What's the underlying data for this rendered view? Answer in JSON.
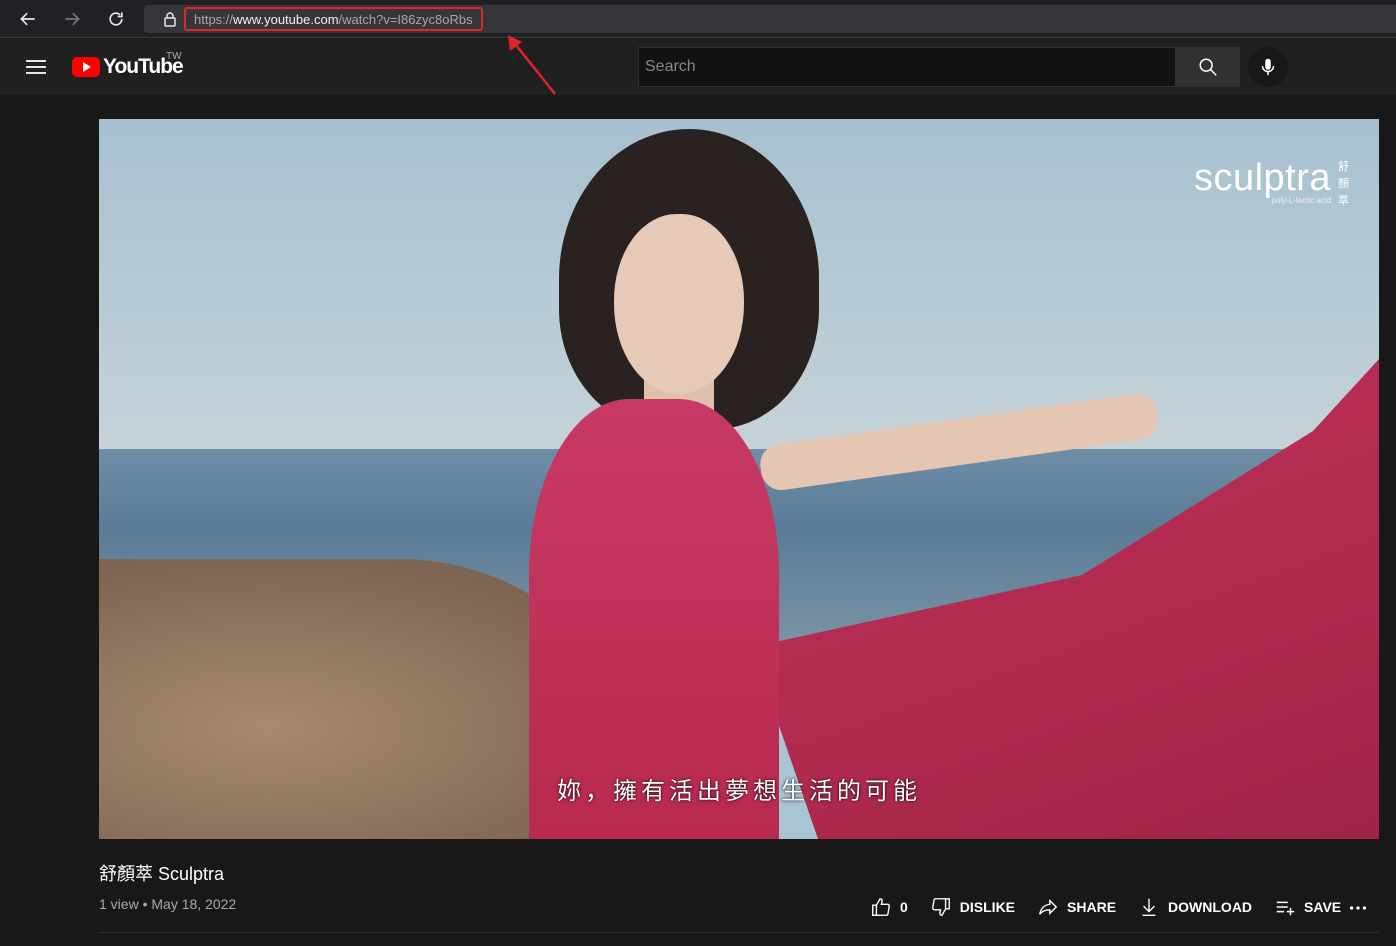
{
  "browser": {
    "url_scheme": "https://",
    "url_host": "www.youtube.com",
    "url_path": "/watch?v=I86zyc8oRbs"
  },
  "header": {
    "logo_text": "YouTube",
    "region": "TW",
    "search_placeholder": "Search"
  },
  "video": {
    "brand": "sculptra",
    "brand_sub": "poly-L-lactic acid",
    "brand_cjk": "舒顏萃",
    "subtitle": "妳，擁有活出夢想生活的可能"
  },
  "info": {
    "title": "舒顏萃 Sculptra",
    "views": "1 view",
    "date": "May 18, 2022",
    "meta_separator": " • "
  },
  "actions": {
    "like_count": "0",
    "dislike": "DISLIKE",
    "share": "SHARE",
    "download": "DOWNLOAD",
    "save": "SAVE"
  },
  "colors": {
    "accent": "#ff0000",
    "annotation": "#e0242b"
  }
}
